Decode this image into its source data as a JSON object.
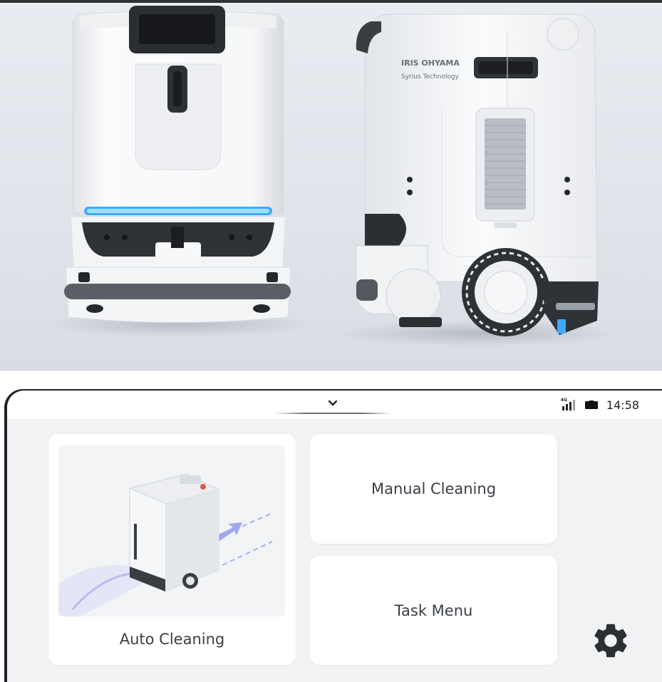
{
  "photo": {
    "brand_name": "IRIS OHYAMA",
    "brand_tagline": "Syrius Technology"
  },
  "status_bar": {
    "network_label": "4G",
    "time": "14:58"
  },
  "icons": {
    "pull_handle": "chevron-down-icon",
    "signal": "signal-icon",
    "battery": "battery-icon",
    "settings": "gear-icon"
  },
  "menu": {
    "auto_cleaning": "Auto Cleaning",
    "manual_cleaning": "Manual Cleaning",
    "task_menu": "Task Menu"
  },
  "colors": {
    "accent_light_strip": "#3fa9ff",
    "screen_background": "#f1f2f4",
    "card_background": "#ffffff",
    "text": "#3a3f45"
  }
}
